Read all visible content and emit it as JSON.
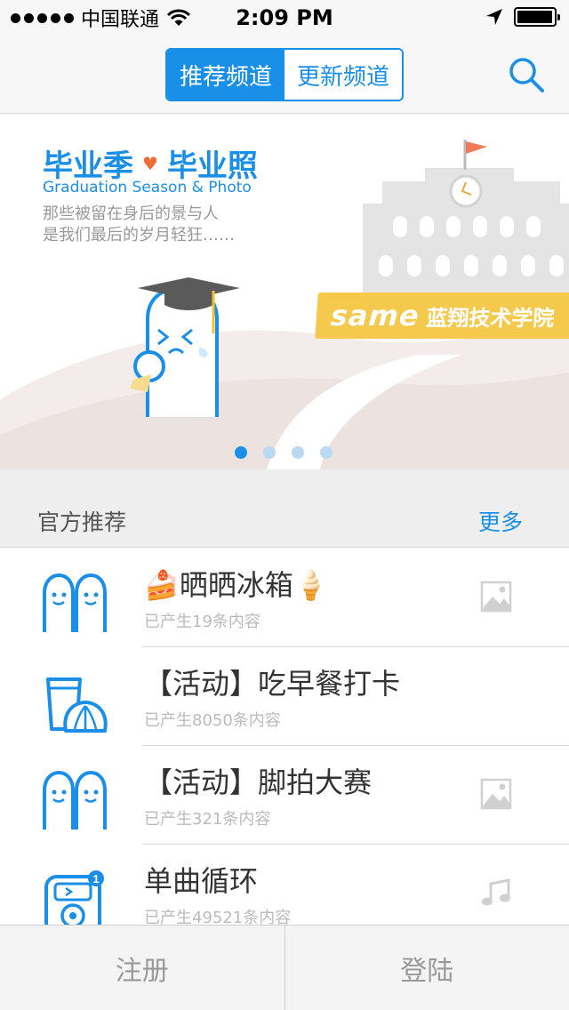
{
  "status_bar": {
    "carrier": "中国联通",
    "time": "2:09 PM"
  },
  "nav": {
    "tabs": [
      {
        "label": "推荐频道",
        "active": true
      },
      {
        "label": "更新频道",
        "active": false
      }
    ],
    "search_icon": "search-icon"
  },
  "banner": {
    "title_left": "毕业季",
    "title_right": "毕业照",
    "subtitle": "Graduation Season & Photo",
    "desc_line1": "那些被留在身后的景与人",
    "desc_line2": "是我们最后的岁月轻狂……",
    "sign_logo": "same",
    "sign_school": "蓝翔技术学院",
    "pages": 4,
    "current_page": 1
  },
  "section": {
    "title": "官方推荐",
    "more": "更多"
  },
  "channels": [
    {
      "name": "🍰晒晒冰箱🍦",
      "count": "已产生19条内容",
      "icon": "twin-ghosts-icon",
      "thumb": "image-icon"
    },
    {
      "name": "【活动】吃早餐打卡",
      "count": "已产生8050条内容",
      "icon": "breakfast-icon",
      "thumb": ""
    },
    {
      "name": "【活动】脚拍大赛",
      "count": "已产生321条内容",
      "icon": "twin-ghosts-icon",
      "thumb": "image-icon"
    },
    {
      "name": "单曲循环",
      "count": "已产生49521条内容",
      "icon": "music-player-icon",
      "thumb": "music-note-icon"
    }
  ],
  "tabbar": {
    "register": "注册",
    "login": "登陆"
  },
  "colors": {
    "accent": "#1a8fe8",
    "banner_sign": "#f5c94c"
  }
}
